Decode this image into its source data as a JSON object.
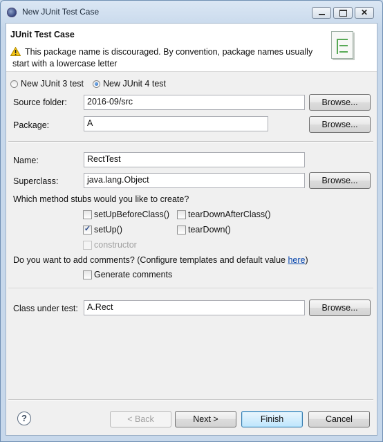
{
  "window": {
    "title": "New JUnit Test Case"
  },
  "header": {
    "title": "JUnit Test Case",
    "warning_line1": "This package name is discouraged. By convention, package names usually",
    "warning_line2": "start with a lowercase letter"
  },
  "junit_version": {
    "option3": "New JUnit 3 test",
    "option4": "New JUnit 4 test",
    "selected": "New JUnit 4 test"
  },
  "source_folder": {
    "label": "Source folder:",
    "value": "2016-09/src",
    "button": "Browse..."
  },
  "package": {
    "label": "Package:",
    "value": "A",
    "button": "Browse..."
  },
  "name": {
    "label": "Name:",
    "value": "RectTest"
  },
  "superclass": {
    "label": "Superclass:",
    "value": "java.lang.Object",
    "button": "Browse..."
  },
  "stubs": {
    "question": "Which method stubs would you like to create?",
    "setUpBeforeClass": {
      "label": "setUpBeforeClass()",
      "checked": false
    },
    "tearDownAfterClass": {
      "label": "tearDownAfterClass()",
      "checked": false
    },
    "setUp": {
      "label": "setUp()",
      "checked": true
    },
    "tearDown": {
      "label": "tearDown()",
      "checked": false
    },
    "constructor": {
      "label": "constructor",
      "checked": false,
      "enabled": false
    }
  },
  "comments": {
    "question_prefix": "Do you want to add comments? (Configure templates and default value ",
    "link": "here",
    "question_suffix": ")",
    "generate_label": "Generate comments",
    "generate_checked": false
  },
  "class_under_test": {
    "label": "Class under test:",
    "value": "A.Rect",
    "button": "Browse..."
  },
  "footer": {
    "back": "< Back",
    "next": "Next >",
    "finish": "Finish",
    "cancel": "Cancel"
  },
  "icons": {
    "app": "eclipse-icon",
    "warning": "warning-icon",
    "banner": "junit-wizard-icon",
    "help": "help-icon"
  }
}
